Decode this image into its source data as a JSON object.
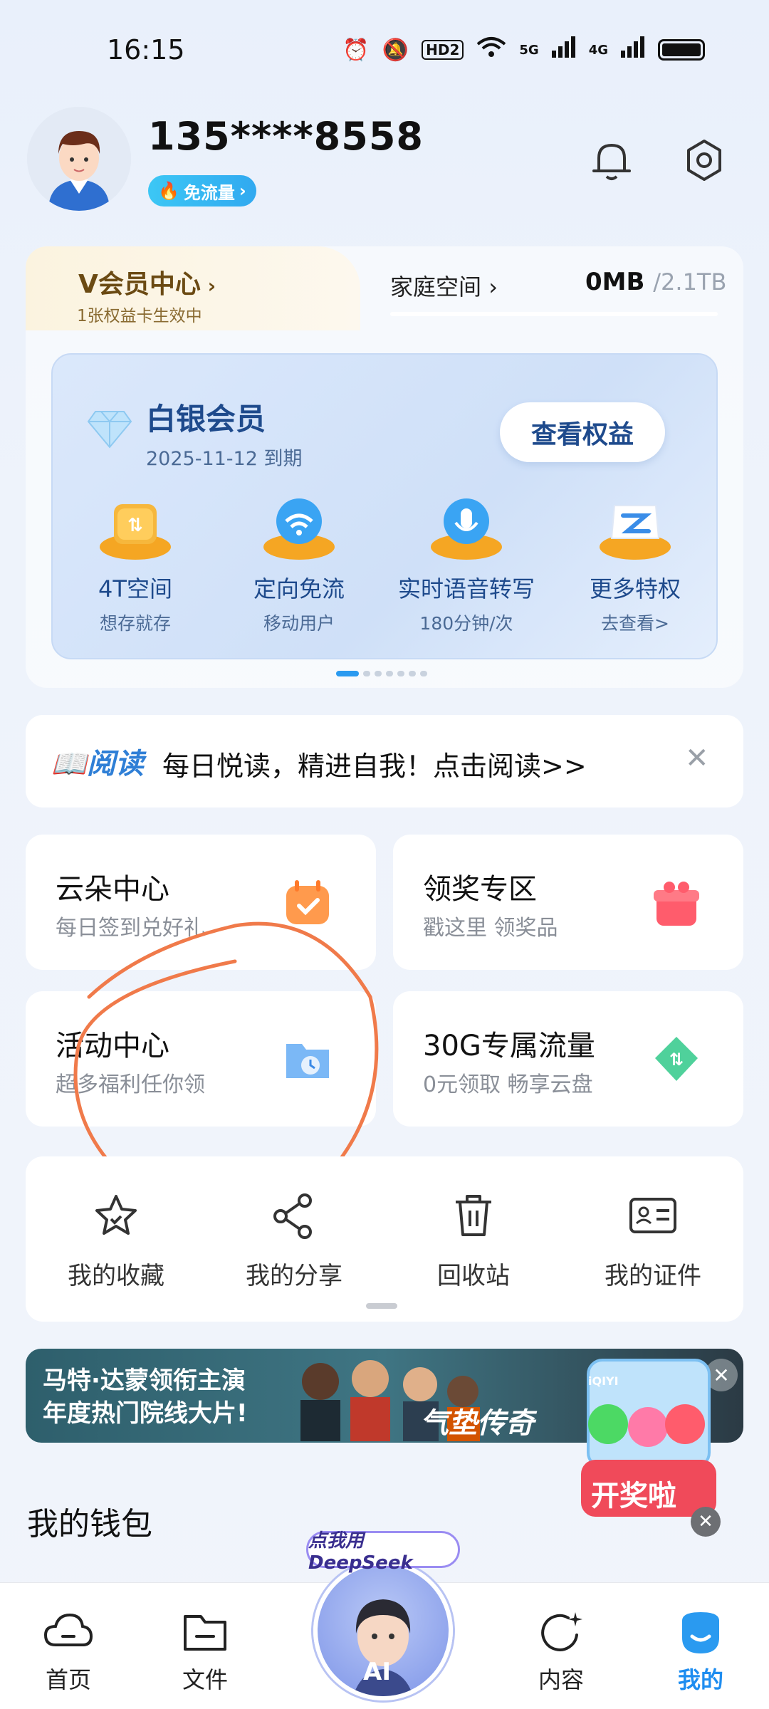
{
  "status_bar": {
    "time": "16:15",
    "hd": "HD2",
    "net1": "5G",
    "net2": "4G"
  },
  "profile": {
    "phone": "135****8558",
    "free_tag": "免流量"
  },
  "membership": {
    "vip_title": "V会员中心",
    "vip_sub": "1张权益卡生效中",
    "family": "家庭空间",
    "storage_used": "0MB",
    "storage_total": "/2.1TB",
    "level_title": "白银会员",
    "expiry": "2025-11-12 到期",
    "view_rights": "查看权益",
    "perks": [
      {
        "name": "4T空间",
        "desc": "想存就存"
      },
      {
        "name": "定向免流",
        "desc": "移动用户"
      },
      {
        "name": "实时语音转写",
        "desc": "180分钟/次"
      },
      {
        "name": "更多特权",
        "desc": "去查看>"
      }
    ]
  },
  "reading": {
    "logo": "阅读",
    "text": "每日悦读，精进自我！点击阅读>>"
  },
  "grid": [
    {
      "title": "云朵中心",
      "sub": "每日签到兑好礼"
    },
    {
      "title": "领奖专区",
      "sub": "戳这里 领奖品"
    },
    {
      "title": "活动中心",
      "sub": "超多福利任你领"
    },
    {
      "title": "30G专属流量",
      "sub": "0元领取 畅享云盘"
    }
  ],
  "shortcuts": [
    "我的收藏",
    "我的分享",
    "回收站",
    "我的证件"
  ],
  "ad": {
    "line1": "马特·达蒙领衔主演",
    "line2": "年度热门院线大片!",
    "title": "气垫传奇",
    "gacha": "开奖啦",
    "gacha_brand": "iQIYI"
  },
  "wallet_title": "我的钱包",
  "nav": {
    "items": [
      "首页",
      "文件",
      "内容",
      "我的"
    ],
    "ai_bubble": "点我用DeepSeek",
    "ai_label": "AI"
  },
  "colors": {
    "accent": "#1e8df0",
    "annotation": "#f07a4a"
  }
}
